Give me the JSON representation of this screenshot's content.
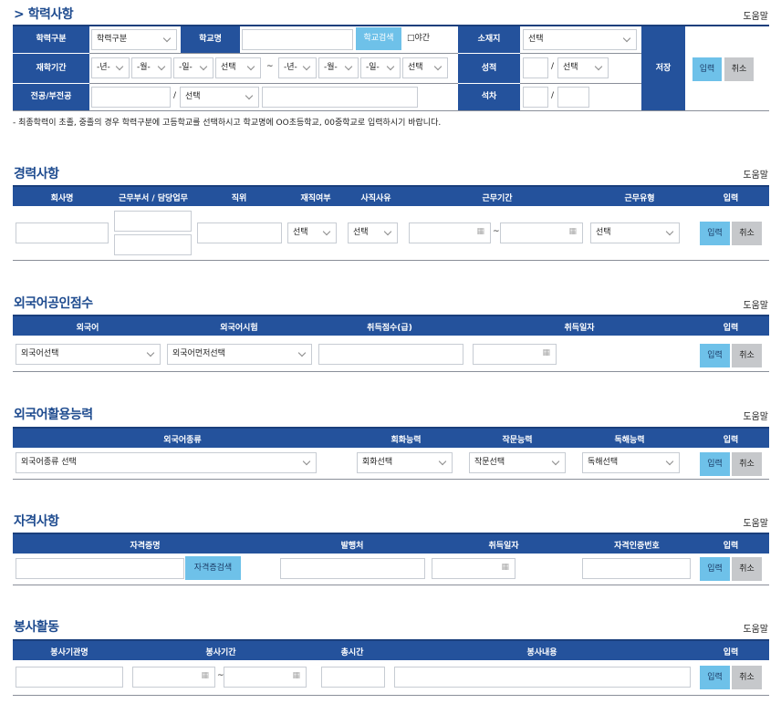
{
  "common": {
    "help": "도움말",
    "input": "입력",
    "cancel": "취소",
    "select": "선택",
    "year": "-년-",
    "month": "-월-",
    "day": "-일-",
    "tilde": "~",
    "slash": "/"
  },
  "education": {
    "title": "> 학력사항",
    "school_type_label": "학력구분",
    "school_type_value": "학력구분",
    "school_name_label": "학교명",
    "school_search": "학교검색",
    "night": "□야간",
    "location_label": "소재지",
    "period_label": "재학기간",
    "grade_label": "성적",
    "major_label": "전공/부전공",
    "rank_label": "석차",
    "save_label": "저장",
    "note": "- 최종학력이 초졸, 중졸의 경우 학력구분에 고등학교를 선택하시고 학교명에 OO초등학교, 00중학교로 입력하시기 바랍니다."
  },
  "career": {
    "title": "경력사항",
    "columns": [
      "회사명",
      "근무부서 / 담당업무",
      "직위",
      "재직여부",
      "사직사유",
      "근무기간",
      "근무유형",
      "입력"
    ]
  },
  "lang_score": {
    "title": "외국어공인점수",
    "columns": [
      "외국어",
      "외국어시험",
      "취득점수(급)",
      "취득일자",
      "입력"
    ],
    "lang_select": "외국어선택",
    "test_select": "외국어먼저선택"
  },
  "lang_ability": {
    "title": "외국어활용능력",
    "columns": [
      "외국어종류",
      "회화능력",
      "작문능력",
      "독해능력",
      "입력"
    ],
    "kind_select": "외국어종류 선택",
    "conv_select": "회화선택",
    "writing_select": "작문선택",
    "reading_select": "독해선택"
  },
  "license": {
    "title": "자격사항",
    "columns": [
      "자격증명",
      "발행처",
      "취득일자",
      "자격인증번호",
      "입력"
    ],
    "search": "자격증검색"
  },
  "volunteer": {
    "title": "봉사활동",
    "columns": [
      "봉사기관명",
      "봉사기간",
      "총시간",
      "봉사내용",
      "입력"
    ]
  }
}
